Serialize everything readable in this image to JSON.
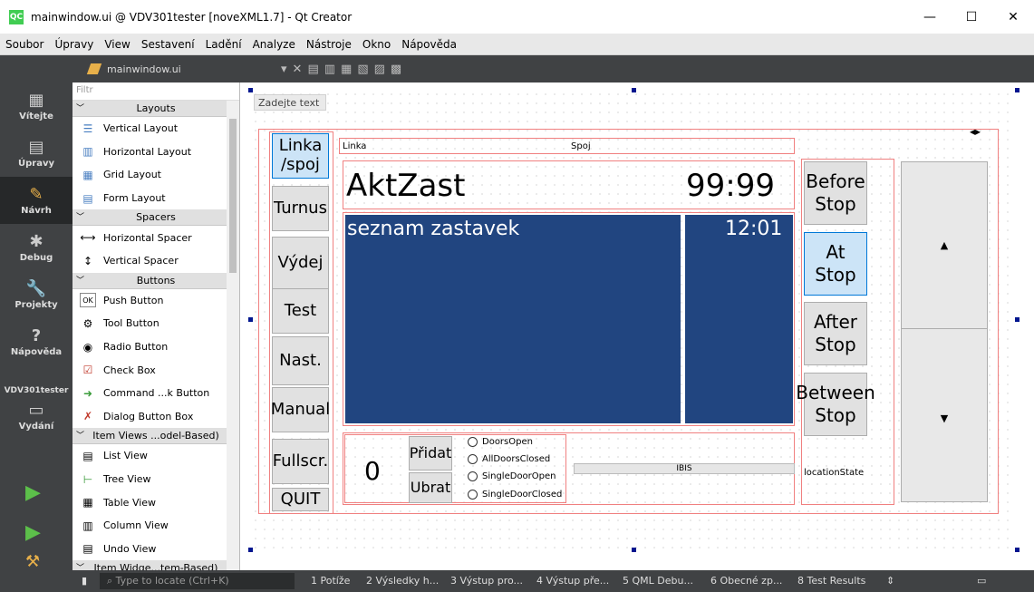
{
  "window": {
    "title": "mainwindow.ui @ VDV301tester [noveXML1.7] - Qt Creator",
    "logo": "QC",
    "minimize": "—",
    "maximize": "☐",
    "close": "✕"
  },
  "menu": [
    "Soubor",
    "Úpravy",
    "View",
    "Sestavení",
    "Ladění",
    "Analyze",
    "Nástroje",
    "Okno",
    "Nápověda"
  ],
  "editor_tab": {
    "file": "mainwindow.ui"
  },
  "modes": [
    {
      "label": "Vítejte",
      "icon": "grid-icon"
    },
    {
      "label": "Úpravy",
      "icon": "document-icon"
    },
    {
      "label": "Návrh",
      "icon": "pencil-icon"
    },
    {
      "label": "Debug",
      "icon": "bug-icon"
    },
    {
      "label": "Projekty",
      "icon": "wrench-icon"
    },
    {
      "label": "Nápověda",
      "icon": "help-icon"
    }
  ],
  "target": {
    "label": "VDV301tester",
    "build_label": "Vydání"
  },
  "widget_box": {
    "filter_placeholder": "Filtr",
    "categories": [
      {
        "name": "Layouts",
        "items": [
          "Vertical Layout",
          "Horizontal Layout",
          "Grid Layout",
          "Form Layout"
        ]
      },
      {
        "name": "Spacers",
        "items": [
          "Horizontal Spacer",
          "Vertical Spacer"
        ]
      },
      {
        "name": "Buttons",
        "items": [
          "Push Button",
          "Tool Button",
          "Radio Button",
          "Check Box",
          "Command ...k Button",
          "Dialog Button Box"
        ]
      },
      {
        "name": "Item Views ...odel-Based)",
        "items": [
          "List View",
          "Tree View",
          "Table View",
          "Column View",
          "Undo View"
        ]
      },
      {
        "name": "Item Widge...tem-Based)",
        "items": []
      }
    ]
  },
  "form": {
    "placeholder": "Zadejte text",
    "left_buttons": [
      "Linka\n/spoj",
      "Turnus",
      "Výdej",
      "Test",
      "Nast.",
      "Manual",
      "Fullscr.",
      "QUIT"
    ],
    "linka_label": "Linka",
    "spoj_label": "Spoj",
    "current_stop": "AktZast",
    "current_time": "99:99",
    "stop_list": "seznam zastavek",
    "list_time": "12:01",
    "counter": "0",
    "add_button": "Přidat",
    "remove_button": "Ubrat",
    "radios": [
      "DoorsOpen",
      "AllDoorsClosed",
      "SingleDoorOpen",
      "SingleDoorClosed"
    ],
    "ibis_label": "IBIS",
    "location_state": "locationState",
    "right_buttons": [
      "Before\nStop",
      "At\nStop",
      "After\nStop",
      "Between\nStop"
    ],
    "scroll_up": "▲",
    "scroll_down": "▼"
  },
  "status": {
    "locate_placeholder": "Type to locate (Ctrl+K)",
    "panes": [
      "1 Potíže",
      "2 Výsledky h...",
      "3 Výstup pro...",
      "4 Výstup pře...",
      "5 QML Debu...",
      "6 Obecné zp...",
      "8 Test Results"
    ]
  }
}
